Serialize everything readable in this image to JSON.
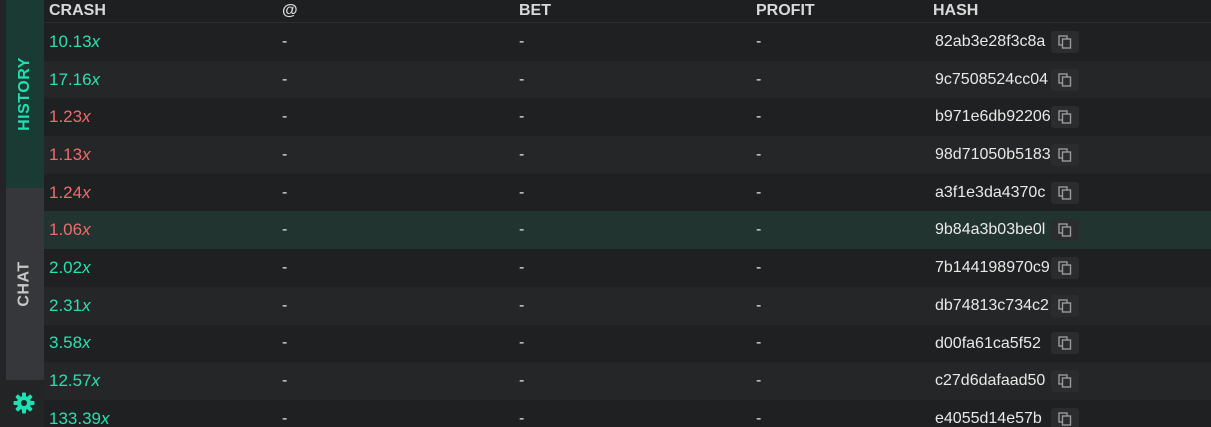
{
  "sidebar": {
    "history_label": "HISTORY",
    "chat_label": "CHAT",
    "settings_icon": "gear-icon",
    "accent_color": "#1fe0b0"
  },
  "table": {
    "headers": {
      "crash": "CRASH",
      "at": "@",
      "bet": "BET",
      "profit": "PROFIT",
      "hash": "HASH"
    },
    "rows": [
      {
        "crash": "10.13",
        "at": "-",
        "bet": "-",
        "profit": "-",
        "hash": "82ab3e28f3c8a",
        "status": "green"
      },
      {
        "crash": "17.16",
        "at": "-",
        "bet": "-",
        "profit": "-",
        "hash": "9c7508524cc04",
        "status": "green"
      },
      {
        "crash": "1.23",
        "at": "-",
        "bet": "-",
        "profit": "-",
        "hash": "b971e6db92206",
        "status": "red"
      },
      {
        "crash": "1.13",
        "at": "-",
        "bet": "-",
        "profit": "-",
        "hash": "98d71050b5183",
        "status": "red"
      },
      {
        "crash": "1.24",
        "at": "-",
        "bet": "-",
        "profit": "-",
        "hash": "a3f1e3da4370c",
        "status": "red"
      },
      {
        "crash": "1.06",
        "at": "-",
        "bet": "-",
        "profit": "-",
        "hash": "9b84a3b03be0l",
        "status": "red",
        "highlighted": true
      },
      {
        "crash": "2.02",
        "at": "-",
        "bet": "-",
        "profit": "-",
        "hash": "7b144198970c9",
        "status": "green"
      },
      {
        "crash": "2.31",
        "at": "-",
        "bet": "-",
        "profit": "-",
        "hash": "db74813c734c2",
        "status": "green"
      },
      {
        "crash": "3.58",
        "at": "-",
        "bet": "-",
        "profit": "-",
        "hash": "d00fa61ca5f52",
        "status": "green"
      },
      {
        "crash": "12.57",
        "at": "-",
        "bet": "-",
        "profit": "-",
        "hash": "c27d6dafaad50",
        "status": "green"
      },
      {
        "crash": "133.39",
        "at": "-",
        "bet": "-",
        "profit": "-",
        "hash": "e4055d14e57b",
        "status": "green"
      }
    ],
    "multiplier_suffix": "x",
    "copy_icon": "copy-icon",
    "colors": {
      "green": "#28e1b1",
      "red": "#f06b6b"
    }
  }
}
